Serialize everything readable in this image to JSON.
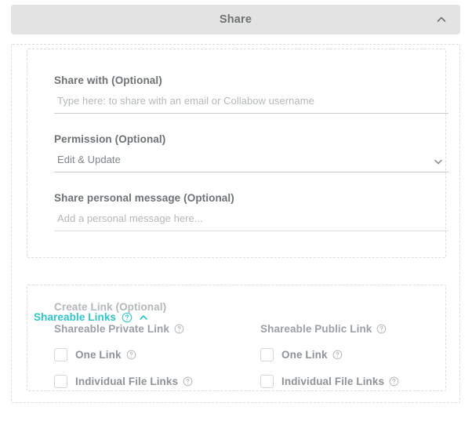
{
  "header": {
    "title": "Share",
    "collapse_icon": "chevron-up-icon"
  },
  "form": {
    "share_with": {
      "label": "Share with (Optional)",
      "placeholder": "Type here: to share with an email or Collabow username",
      "value": ""
    },
    "permission": {
      "label": "Permission (Optional)",
      "value": "Edit & Update",
      "chevron_icon": "chevron-down-icon"
    },
    "personal_message": {
      "label": "Share personal message (Optional)",
      "placeholder": "Add a personal message here...",
      "value": ""
    }
  },
  "shareable_links": {
    "label": "Shareable Links",
    "help_icon": "help-circle-icon",
    "toggle_icon": "chevron-up-icon",
    "accent_color": "#2cc6c6",
    "create_link_label": "Create Link (Optional)",
    "columns": [
      {
        "heading": "Shareable Private Link",
        "help_icon": "help-circle-icon",
        "options": [
          {
            "label": "One Link",
            "checked": false,
            "help_icon": "help-circle-icon"
          },
          {
            "label": "Individual File Links",
            "checked": false,
            "help_icon": "help-circle-icon"
          }
        ]
      },
      {
        "heading": "Shareable Public Link",
        "help_icon": "help-circle-icon",
        "options": [
          {
            "label": "One Link",
            "checked": false,
            "help_icon": "help-circle-icon"
          },
          {
            "label": "Individual File Links",
            "checked": false,
            "help_icon": "help-circle-icon"
          }
        ]
      }
    ]
  }
}
